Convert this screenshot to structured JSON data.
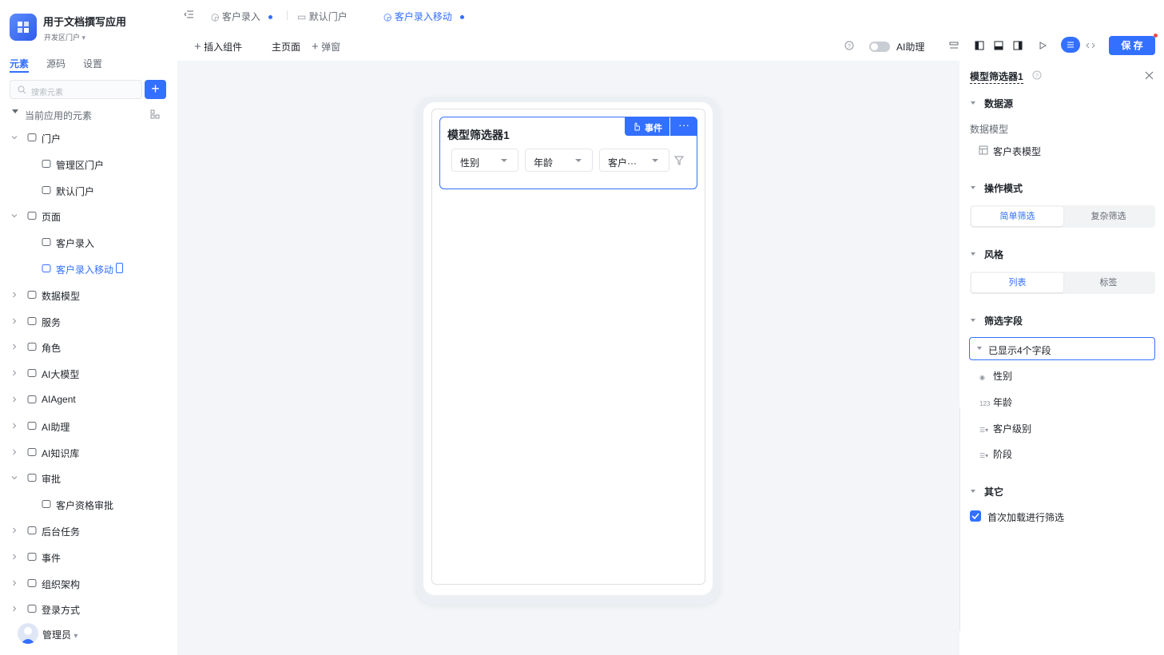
{
  "app": {
    "title": "用于文档撰写应用",
    "subtitle": "开发区门户"
  },
  "left_tabs": [
    "元素",
    "源码",
    "设置"
  ],
  "search": {
    "placeholder": "搜索元素"
  },
  "tree": {
    "root_label": "当前应用的元素",
    "items": [
      {
        "label": "门户",
        "icon": "home-icon",
        "level": 0,
        "expanded": true
      },
      {
        "label": "管理区门户",
        "icon": "portal-icon",
        "level": 1
      },
      {
        "label": "默认门户",
        "icon": "portal-icon",
        "level": 1
      },
      {
        "label": "页面",
        "icon": "pages-icon",
        "level": 0,
        "expanded": true
      },
      {
        "label": "客户录入",
        "icon": "page-icon",
        "level": 1
      },
      {
        "label": "客户录入移动",
        "icon": "page-icon",
        "level": 1,
        "selected": true
      },
      {
        "label": "数据模型",
        "icon": "table-icon",
        "level": 0
      },
      {
        "label": "服务",
        "icon": "service-icon",
        "level": 0
      },
      {
        "label": "角色",
        "icon": "role-icon",
        "level": 0
      },
      {
        "label": "AI大模型",
        "icon": "ai-model-icon",
        "level": 0
      },
      {
        "label": "AIAgent",
        "icon": "robot-icon",
        "level": 0
      },
      {
        "label": "AI助理",
        "icon": "ai-assistant-icon",
        "level": 0
      },
      {
        "label": "AI知识库",
        "icon": "book-icon",
        "level": 0
      },
      {
        "label": "审批",
        "icon": "stamp-icon",
        "level": 0,
        "expanded": true
      },
      {
        "label": "客户资格审批",
        "icon": "stamp-icon",
        "level": 1
      },
      {
        "label": "后台任务",
        "icon": "task-icon",
        "level": 0
      },
      {
        "label": "事件",
        "icon": "event-icon",
        "level": 0
      },
      {
        "label": "组织架构",
        "icon": "org-icon",
        "level": 0
      },
      {
        "label": "登录方式",
        "icon": "login-icon",
        "level": 0
      }
    ]
  },
  "user": {
    "name": "管理员",
    "avatar_text": "管理员"
  },
  "doc_tabs": [
    {
      "label": "客户录入",
      "dot": true
    },
    {
      "label": "默认门户",
      "dot": false
    },
    {
      "label": "客户录入移动",
      "dot": true,
      "active": true
    }
  ],
  "toolbar": {
    "insert": "插入组件",
    "main_page": "主页面",
    "popup": "弹窗",
    "ai_assistant": "AI助理",
    "save": "保 存"
  },
  "canvas": {
    "widget_title": "模型筛选器1",
    "event_button": "事件",
    "more_button": "···",
    "filters": [
      "性别",
      "年龄",
      "客户···"
    ]
  },
  "props": {
    "title": "模型筛选器1",
    "datasource": {
      "section": "数据源",
      "label": "数据模型",
      "model": "客户表模型"
    },
    "mode": {
      "section": "操作模式",
      "options": [
        "简单筛选",
        "复杂筛选"
      ],
      "selected": "简单筛选"
    },
    "style": {
      "section": "风格",
      "options": [
        "列表",
        "标签"
      ],
      "selected": "列表"
    },
    "fields": {
      "section": "筛选字段",
      "summary": "已显示4个字段",
      "items": [
        {
          "label": "性别",
          "type_icon": "◉"
        },
        {
          "label": "年龄",
          "type_icon": "123"
        },
        {
          "label": "客户级别",
          "type_icon": "☰▾"
        },
        {
          "label": "阶段",
          "type_icon": "☰▾"
        }
      ]
    },
    "other": {
      "section": "其它",
      "first_load_filter": "首次加载进行筛选",
      "checked": true
    }
  },
  "colors": {
    "accent": "#3370ff",
    "text": "#1f2329",
    "muted": "#646a73"
  }
}
